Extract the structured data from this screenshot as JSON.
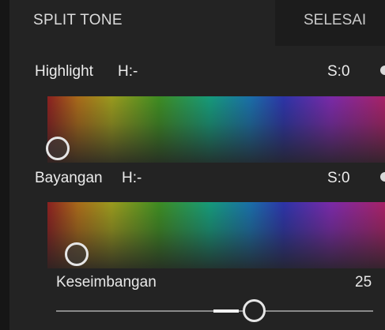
{
  "header": {
    "title": "SPLIT TONE",
    "done_label": "SELESAI"
  },
  "highlight": {
    "label": "Highlight",
    "hue_text": "H:-",
    "saturation_text": "S:0"
  },
  "shadow": {
    "label": "Bayangan",
    "hue_text": "H:-",
    "saturation_text": "S:0"
  },
  "balance": {
    "label": "Keseimbangan",
    "value": "25"
  },
  "colors": {
    "background": "#232323",
    "knob_stroke": "#e6e6e6",
    "track": "#8a8a8a",
    "track_active": "#f2f2f2"
  }
}
